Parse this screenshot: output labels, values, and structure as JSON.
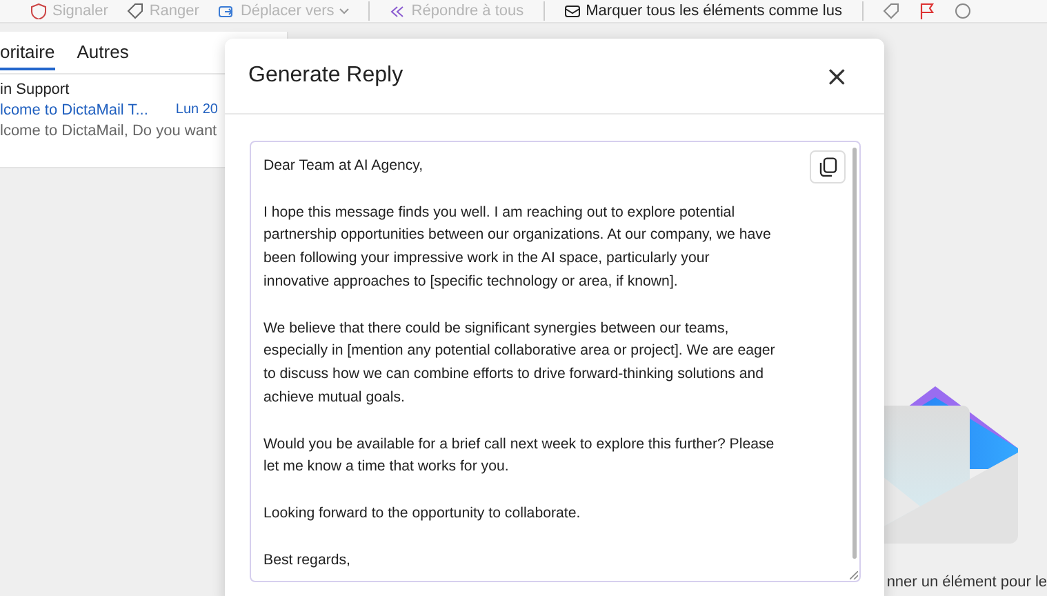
{
  "toolbar": [
    {
      "label": "Signaler",
      "disabled": true
    },
    {
      "label": "Ranger",
      "disabled": true
    },
    {
      "label": "Déplacer vers",
      "disabled": true,
      "dropdown": true
    },
    {
      "label": "Répondre à tous",
      "disabled": true
    },
    {
      "label": "Marquer tous les éléments comme lus",
      "disabled": false
    }
  ],
  "mail_list": {
    "tabs": [
      {
        "label": "oritaire",
        "selected": true
      },
      {
        "label": "Autres",
        "selected": false
      }
    ],
    "items": [
      {
        "sender": "in Support",
        "subject": "lcome to DictaMail T...",
        "date": "Lun 20",
        "preview": "lcome to DictaMail, Do you want"
      }
    ]
  },
  "dialog": {
    "title": "Generate Reply",
    "close": "×",
    "reply_paragraphs": [
      [
        "Dear Team at AI Agency,"
      ],
      [
        "I hope this message finds you well. I am reaching out to explore potential",
        "partnership opportunities between our organizations. At our company, we have",
        "been following your impressive work in the AI space, particularly your",
        "innovative approaches to [specific technology or area, if known]."
      ],
      [
        "We believe that there could be significant synergies between our teams,",
        "especially in [mention any potential collaborative area or project]. We are eager",
        "to discuss how we can combine efforts to drive forward-thinking solutions and",
        "achieve mutual goals."
      ],
      [
        "Would you be available for a brief call next week to explore this further? Please",
        "let me know a time that works for you."
      ],
      [
        "Looking forward to the opportunity to collaborate."
      ],
      [
        "Best regards,"
      ]
    ]
  },
  "reading_pane": {
    "hint": "nner un élément pour le"
  }
}
